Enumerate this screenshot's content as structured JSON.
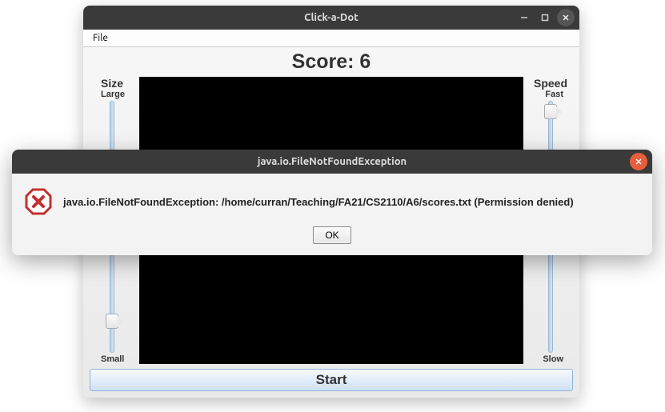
{
  "main_window": {
    "title": "Click-a-Dot",
    "menubar": {
      "file": "File"
    },
    "score_label": "Score: 6",
    "size": {
      "title": "Size",
      "top": "Large",
      "bottom": "Small",
      "thumb_percent": 84
    },
    "speed": {
      "title": "Speed",
      "top": "Fast",
      "bottom": "Slow",
      "thumb_percent": 2
    },
    "start_label": "Start"
  },
  "dialog": {
    "title": "java.io.FileNotFoundException",
    "message": "java.io.FileNotFoundException: /home/curran/Teaching/FA21/CS2110/A6/scores.txt (Permission denied)",
    "ok_label": "OK"
  }
}
